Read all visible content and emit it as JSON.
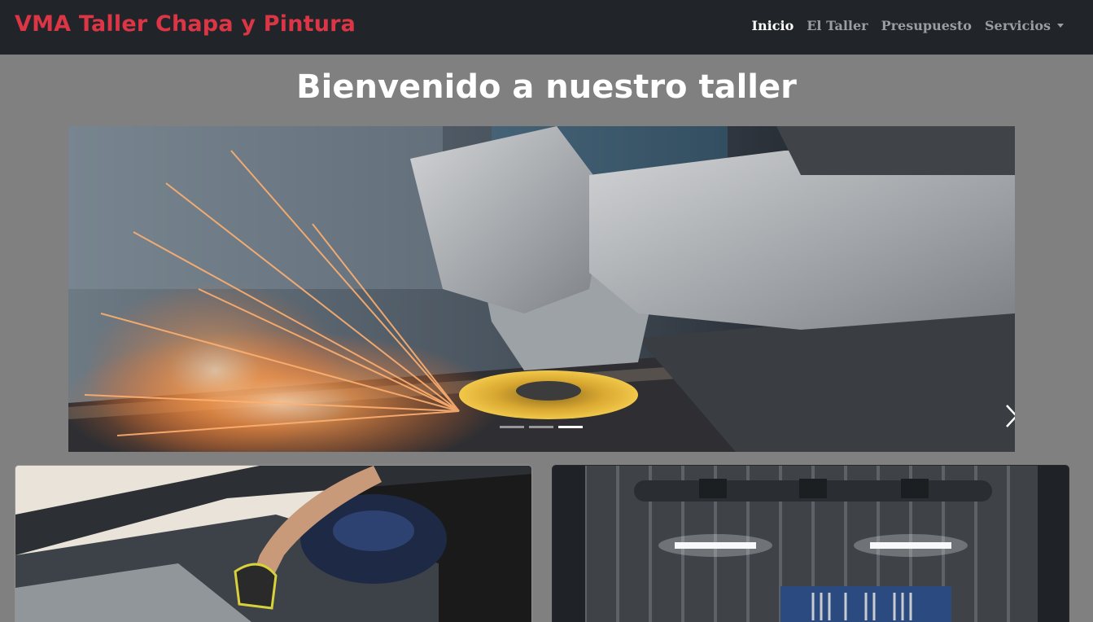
{
  "navbar": {
    "brand": "VMA Taller Chapa y Pintura",
    "links": [
      {
        "label": "Inicio",
        "active": true
      },
      {
        "label": "El Taller",
        "active": false
      },
      {
        "label": "Presupuesto",
        "active": false
      },
      {
        "label": "Servicios",
        "active": false,
        "dropdown": true
      }
    ]
  },
  "hero": {
    "title": "Bienvenido a nuestro taller"
  },
  "carousel": {
    "slide_count": 3,
    "active_index": 2,
    "next_icon": "chevron-right-icon"
  },
  "cards": [
    {
      "image": "mechanic-engine-photo"
    },
    {
      "image": "garage-tools-photo"
    }
  ],
  "colors": {
    "navbar_bg": "#212529",
    "brand": "#dc3545",
    "page_bg": "#808080"
  }
}
